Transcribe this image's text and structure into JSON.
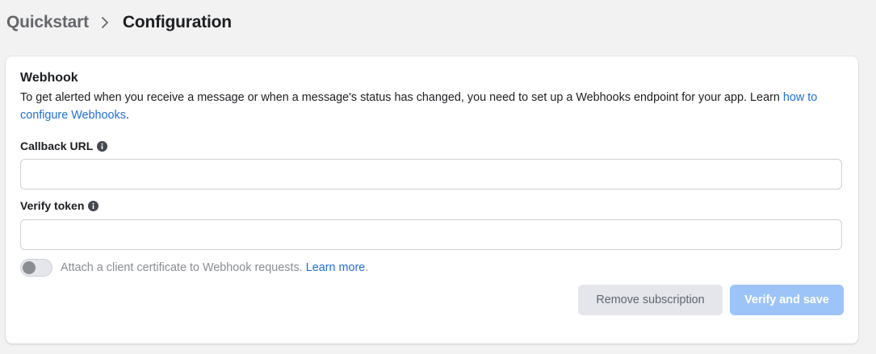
{
  "breadcrumb": {
    "parent": "Quickstart",
    "separator_icon": "chevron-right-icon",
    "current": "Configuration"
  },
  "webhook": {
    "title": "Webhook",
    "description": "To get alerted when you receive a message or when a message's status has changed, you need to set up a Webhooks endpoint for your app. Learn",
    "description_link": "how to configure Webhooks",
    "description_end": ".",
    "callback_url": {
      "label": "Callback URL",
      "icon": "info-icon",
      "value": "",
      "placeholder": ""
    },
    "verify_token": {
      "label": "Verify token",
      "icon": "info-icon",
      "value": "",
      "placeholder": ""
    },
    "client_cert": {
      "label": "Attach a client certificate to Webhook requests.",
      "link": "Learn more",
      "link_end": ".",
      "enabled": false
    },
    "buttons": {
      "remove": "Remove subscription",
      "verify": "Verify and save"
    }
  },
  "colors": {
    "link": "#216fdb",
    "primary_disabled": "#9cc4f8",
    "secondary_button": "#e4e6eb",
    "background": "#f2f2f2"
  }
}
